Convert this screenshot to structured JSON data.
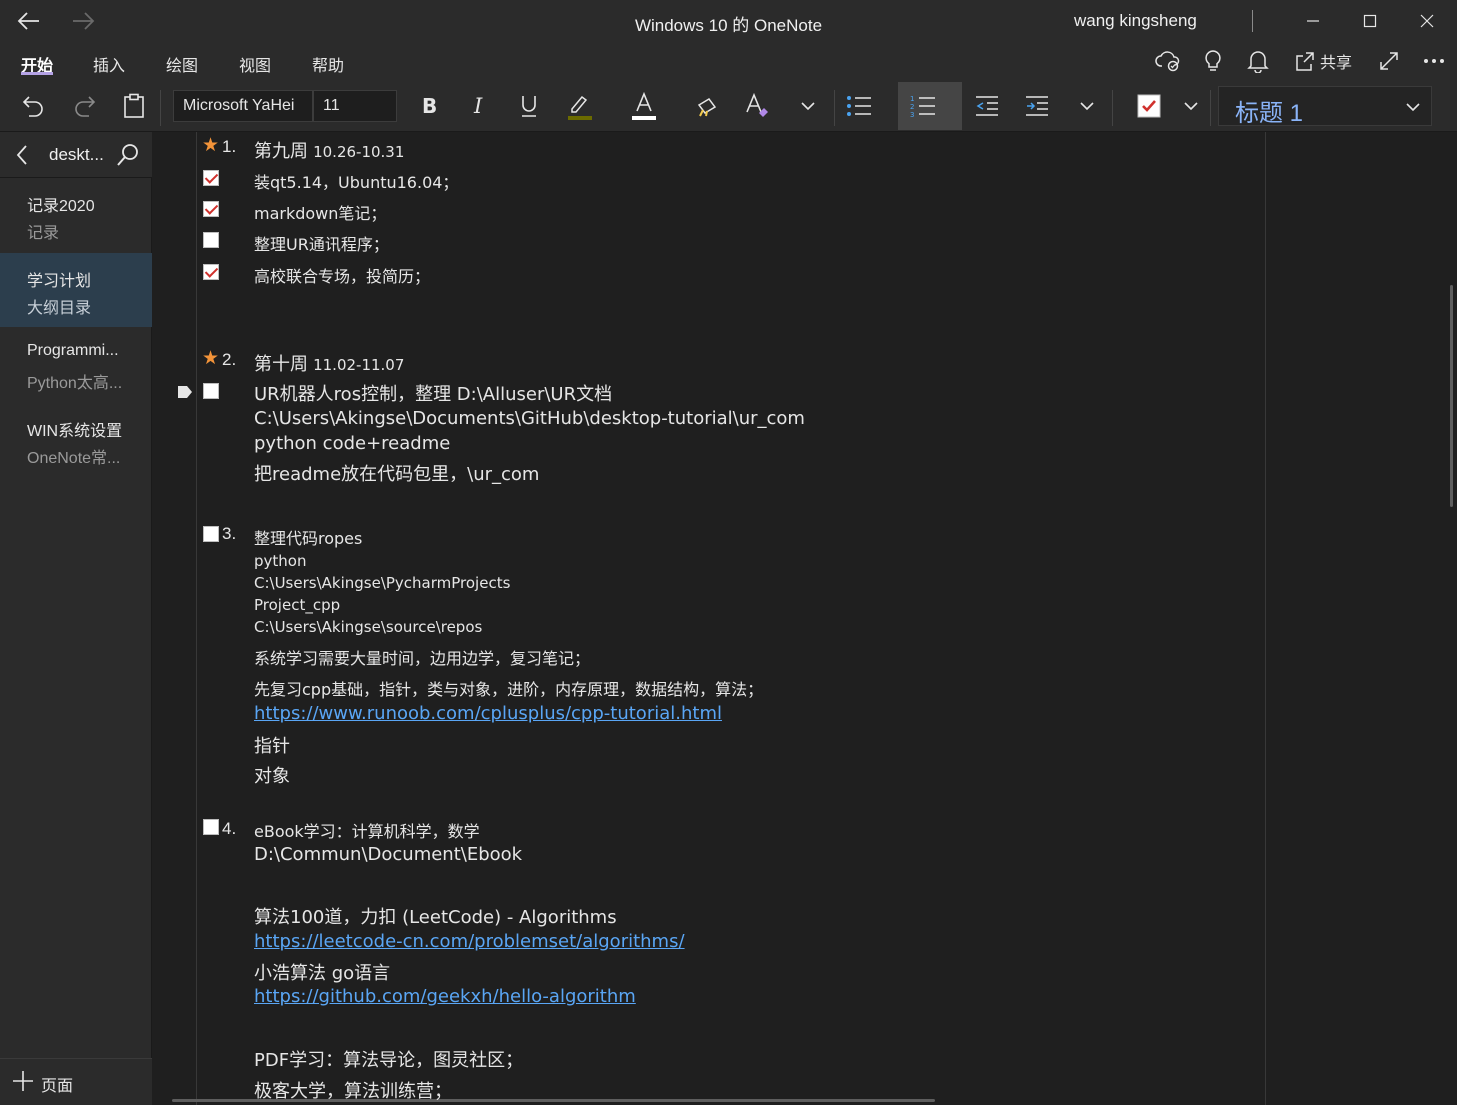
{
  "window": {
    "title": "Windows 10 的 OneNote",
    "user": "wang kingsheng"
  },
  "ribbon": {
    "tabs": [
      "开始",
      "插入",
      "绘图",
      "视图",
      "帮助"
    ],
    "active_tab": "开始",
    "share_label": "共享"
  },
  "toolbar": {
    "font_name": "Microsoft YaHei",
    "font_size": "11",
    "style": "标题 1"
  },
  "sidebar": {
    "section_label": "deskt...",
    "pages": [
      {
        "title": "记录2020",
        "subtitle": "记录",
        "selected": false
      },
      {
        "title": "学习计划",
        "subtitle": "大纲目录",
        "selected": true
      },
      {
        "title": "Programmi...",
        "subtitle": "Python太高...",
        "selected": false
      },
      {
        "title": "WIN系统设置",
        "subtitle": "OneNote常...",
        "selected": false
      }
    ],
    "add_page_label": "页面"
  },
  "note": {
    "item1": {
      "number": "1.",
      "heading": "第九周",
      "dates": "10.26-10.31",
      "tasks": [
        {
          "text": "装qt5.14，Ubuntu16.04；",
          "checked": true
        },
        {
          "text": "markdown笔记；",
          "checked": true
        },
        {
          "text": "整理UR通讯程序；",
          "checked": false
        },
        {
          "text": "高校联合专场，投简历；",
          "checked": true
        }
      ]
    },
    "item2": {
      "number": "2.",
      "heading": "第十周",
      "dates": "11.02-11.07",
      "task": "UR机器人ros控制，整理 D:\\Alluser\\UR文档",
      "lines": [
        "C:\\Users\\Akingse\\Documents\\GitHub\\desktop-tutorial\\ur_com",
        "python code+readme",
        "把readme放在代码包里，\\ur_com"
      ]
    },
    "item3": {
      "number": "3.",
      "heading": "整理代码ropes",
      "small_lines": [
        "python",
        "C:\\Users\\Akingse\\PycharmProjects",
        "Project_cpp",
        "C:\\Users\\Akingse\\source\\repos"
      ],
      "line_a": "系统学习需要大量时间，边用边学，复习笔记；",
      "line_b": "先复习cpp基础，指针，类与对象，进阶，内存原理，数据结构，算法；",
      "link": "https://www.runoob.com/cplusplus/cpp-tutorial.html",
      "line_c": "指针",
      "line_d": "对象"
    },
    "item4": {
      "number": "4.",
      "heading": "eBook学习：计算机科学，数学",
      "path": "D:\\Commun\\Document\\Ebook",
      "algo_line": "算法100道，力扣 (LeetCode) - Algorithms",
      "link1": "https://leetcode-cn.com/problemset/algorithms/",
      "go_line": "小浩算法 go语言",
      "link2": "https://github.com/geekxh/hello-algorithm",
      "pdf_line": "PDF学习：算法导论，图灵社区；",
      "geek_line": "极客大学，算法训练营；"
    }
  },
  "colors": {
    "background": "#1f1f1f",
    "chrome": "#2b2b2b",
    "accent_star": "#f29339",
    "link": "#5aa6f5",
    "style_text": "#8ab4f8",
    "selected_page": "#2c3e4d"
  }
}
